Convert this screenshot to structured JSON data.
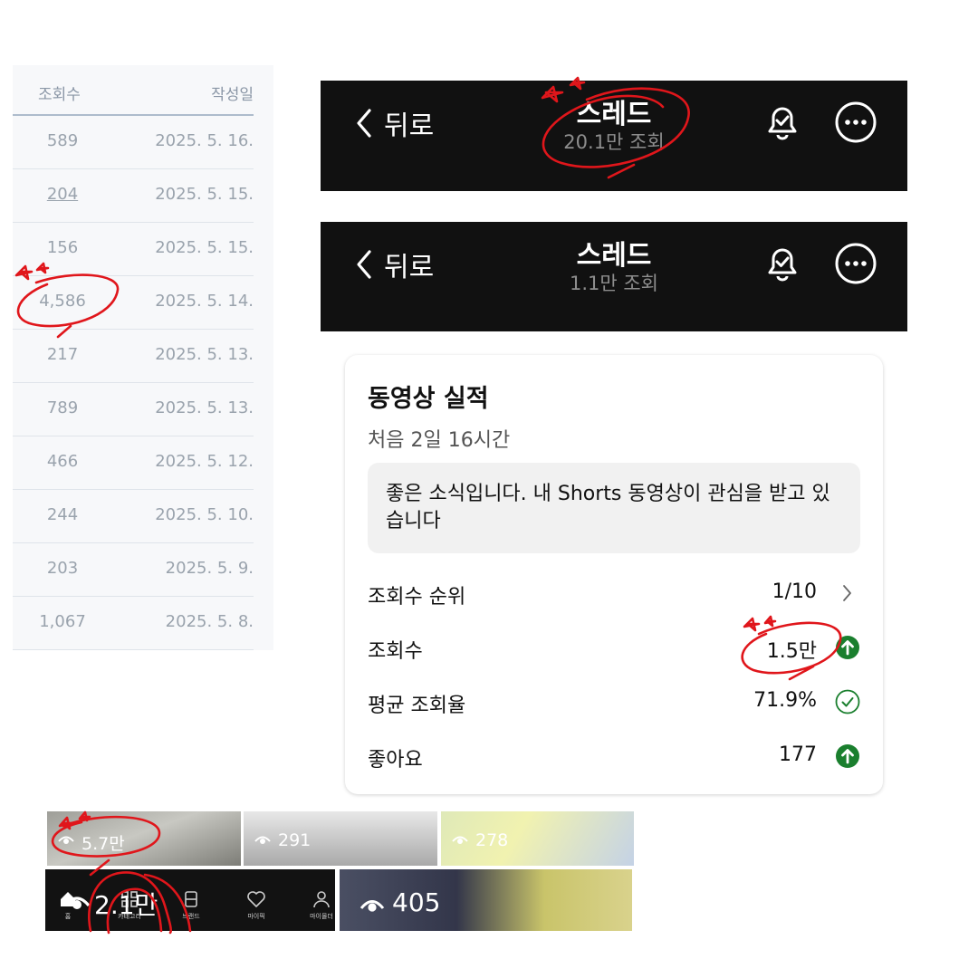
{
  "table": {
    "headers": {
      "views": "조회수",
      "date": "작성일"
    },
    "rows": [
      {
        "views": "589",
        "date": "2025. 5. 16."
      },
      {
        "views": "204",
        "date": "2025. 5. 15."
      },
      {
        "views": "156",
        "date": "2025. 5. 15."
      },
      {
        "views": "4,586",
        "date": "2025. 5. 14."
      },
      {
        "views": "217",
        "date": "2025. 5. 13."
      },
      {
        "views": "789",
        "date": "2025. 5. 13."
      },
      {
        "views": "466",
        "date": "2025. 5. 12."
      },
      {
        "views": "244",
        "date": "2025. 5. 10."
      },
      {
        "views": "203",
        "date": "2025. 5. 9."
      },
      {
        "views": "1,067",
        "date": "2025. 5. 8."
      }
    ]
  },
  "header1": {
    "back": "뒤로",
    "title": "스레드",
    "subtitle": "20.1만 조회"
  },
  "header2": {
    "back": "뒤로",
    "title": "스레드",
    "subtitle": "1.1만 조회"
  },
  "performance": {
    "title": "동영상 실적",
    "period": "처음 2일 16시간",
    "notice": "좋은 소식입니다. 내 Shorts 동영상이 관심을 받고 있습니다",
    "metrics": [
      {
        "label": "조회수 순위",
        "value": "1/10",
        "icon": "chevron-right-icon"
      },
      {
        "label": "조회수",
        "value": "1.5만",
        "icon": "arrow-up-circle-icon"
      },
      {
        "label": "평균 조회율",
        "value": "71.9%",
        "icon": "check-circle-icon"
      },
      {
        "label": "좋아요",
        "value": "177",
        "icon": "arrow-up-circle-icon"
      }
    ]
  },
  "thumbnails": [
    {
      "views": "5.7만"
    },
    {
      "views": "291"
    },
    {
      "views": "278"
    },
    {
      "views": "2.1만"
    },
    {
      "views": "405"
    }
  ],
  "bottom_nav": [
    "홈",
    "카테고리",
    "브랜드",
    "마이픽",
    "마이몰더"
  ],
  "colors": {
    "dark_bar": "#111111",
    "accent_green": "#1a7f2e",
    "annotation_red": "#e0161b"
  }
}
